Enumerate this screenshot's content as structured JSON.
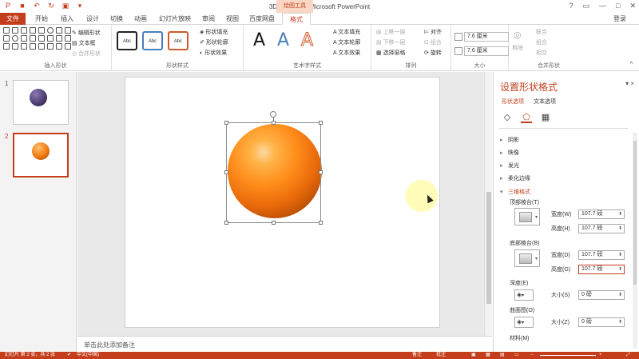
{
  "window": {
    "title": "3D球体.pptx - Microsoft PowerPoint",
    "context_tab_group": "绘图工具",
    "sign_in": "登录",
    "help": "?",
    "qat_icons": [
      "save-icon",
      "undo-icon",
      "redo-icon",
      "present-icon",
      "customize-icon"
    ]
  },
  "tabs": [
    {
      "label": "文件"
    },
    {
      "label": "开始"
    },
    {
      "label": "插入"
    },
    {
      "label": "设计"
    },
    {
      "label": "切换"
    },
    {
      "label": "动画"
    },
    {
      "label": "幻灯片放映"
    },
    {
      "label": "审阅"
    },
    {
      "label": "视图"
    },
    {
      "label": "百度网盘"
    },
    {
      "label": "格式"
    }
  ],
  "ribbon": {
    "insert_shapes": {
      "label": "插入形状",
      "edit_shape": "编辑形状",
      "text_box": "文本框",
      "merge_shapes": "合并形状"
    },
    "shape_styles": {
      "label": "形状样式",
      "fill": "形状填充",
      "outline": "形状轮廓",
      "effects": "形状效果",
      "style_text": "Abc"
    },
    "wordart": {
      "label": "艺术字样式",
      "letters": [
        "A",
        "A",
        "A"
      ],
      "text_fill": "文本填充",
      "text_outline": "文本轮廓",
      "text_effects": "文本效果"
    },
    "arrange": {
      "label": "排列",
      "bring_forward": "上移一层",
      "send_backward": "下移一层",
      "selection_pane": "选择窗格",
      "align": "对齐",
      "group": "组合",
      "rotate": "旋转"
    },
    "size": {
      "label": "大小",
      "height": "7.6 厘米",
      "width": "7.6 厘米"
    },
    "merge": {
      "label": "合并形状",
      "cut": "剪除",
      "union": "联合",
      "combine": "组合",
      "intersect": "相交"
    }
  },
  "slides": [
    {
      "number": "1",
      "ball_color": "#4a3a6e"
    },
    {
      "number": "2",
      "ball_color": "#f07a10"
    }
  ],
  "notes_placeholder": "单击此处添加备注",
  "format_pane": {
    "title": "设置形状格式",
    "close": "×",
    "tabs": [
      "形状选项",
      "文本选项"
    ],
    "sections": [
      {
        "label": "阴影"
      },
      {
        "label": "映像"
      },
      {
        "label": "发光"
      },
      {
        "label": "柔化边缘"
      },
      {
        "label": "三维格式"
      }
    ],
    "three_d": {
      "top_bevel": "顶部棱台(T)",
      "bottom_bevel": "底部棱台(B)",
      "width_label": "宽度(W)",
      "height_label": "高度(H)",
      "width_label_b": "宽度(D)",
      "height_label_b": "高度(G)",
      "top_width": "107.7 磅",
      "top_height": "107.7 磅",
      "bottom_width": "107.7 磅",
      "bottom_height": "107.7 磅",
      "depth": "深度(E)",
      "depth_size_label": "大小(S)",
      "depth_size": "0 磅",
      "contour": "曲面图(O)",
      "contour_size_label": "大小(Z)",
      "contour_size": "0 磅",
      "material": "材料(M)"
    }
  },
  "status_bar": {
    "slide_info": "幻灯片 第 2 张，共 2 张",
    "language": "中文(中国)",
    "notes": "备注",
    "comments": "批注"
  },
  "colors": {
    "accent": "#c43e1c",
    "sphere": "#f07a10"
  }
}
